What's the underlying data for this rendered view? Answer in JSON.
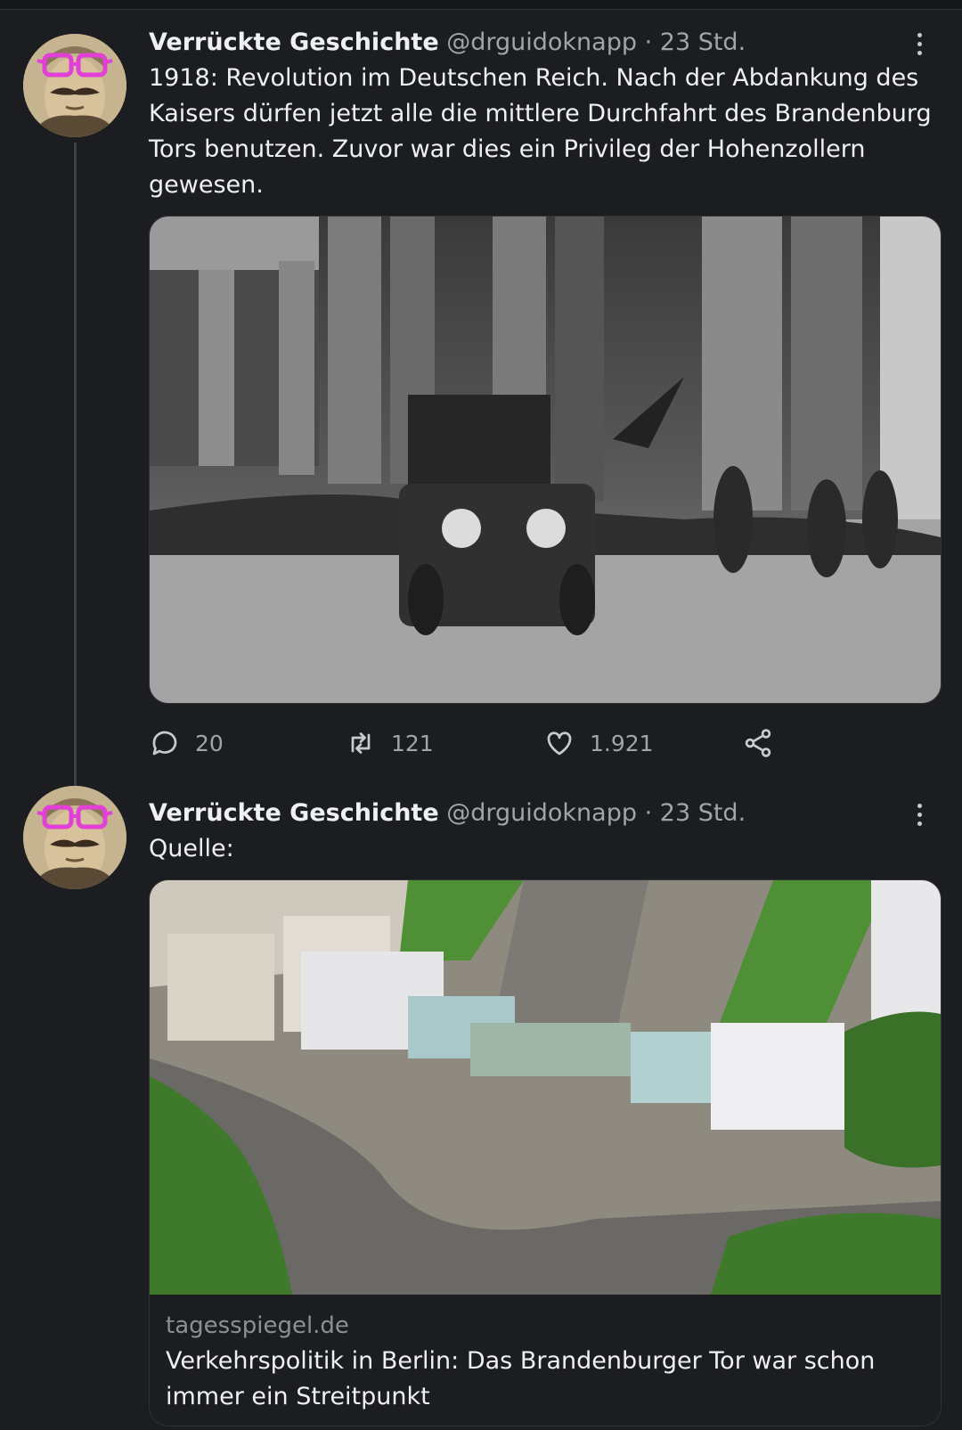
{
  "tweets": [
    {
      "name": "Verrückte Geschichte",
      "handle": "@drguidoknapp",
      "separator": "·",
      "time": "23 Std.",
      "text": "1918: Revolution im Deutschen Reich. Nach der Abdankung des Kaisers dürfen jetzt alle die mittlere Durchfahrt des Brandenburg Tors benutzen. Zuvor war dies ein Privileg der Hohenzollern gewesen.",
      "actions": {
        "replies": "20",
        "retweets": "121",
        "likes": "1.921"
      }
    },
    {
      "name": "Verrückte Geschichte",
      "handle": "@drguidoknapp",
      "separator": "·",
      "time": "23 Std.",
      "text": "Quelle:",
      "card": {
        "domain": "tagesspiegel.de",
        "title": "Verkehrspolitik in Berlin: Das Brandenburger Tor war schon immer ein Streitpunkt"
      }
    }
  ],
  "icons": {
    "reply": "reply-icon",
    "retweet": "retweet-icon",
    "like": "heart-icon",
    "share": "share-icon",
    "more": "more-vertical-icon"
  },
  "colors": {
    "background": "#1c1d20",
    "text": "#eef0f1",
    "secondary": "#a0a5ab",
    "border": "#2f3336"
  }
}
